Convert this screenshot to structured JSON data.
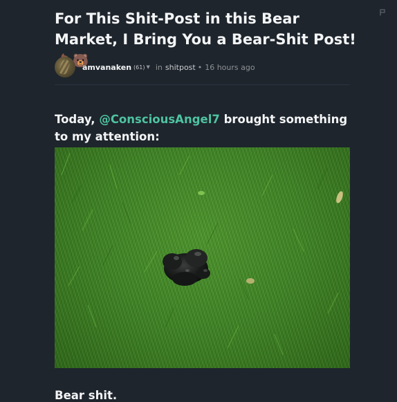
{
  "post": {
    "title": "For This Shit-Post in this Bear Market, I Bring You a Bear-Shit Post!",
    "title_emoji": "💩🐻",
    "author": "amvanaken",
    "reputation": "(61)",
    "in_label": "in",
    "community": "shitpost",
    "separator": "•",
    "time": "16 hours ago",
    "intro_before": "Today, ",
    "mention": "@ConsciousAngel7",
    "intro_after": " brought something to my attention:",
    "closing": "Bear shit."
  },
  "icons": {
    "flag": "flag-icon",
    "caret": "caret-down-icon",
    "avatar": "user-avatar"
  },
  "colors": {
    "background": "#1e252d",
    "text": "#f3f4f5",
    "mention": "#4fc3a1",
    "muted": "#8f9295"
  }
}
